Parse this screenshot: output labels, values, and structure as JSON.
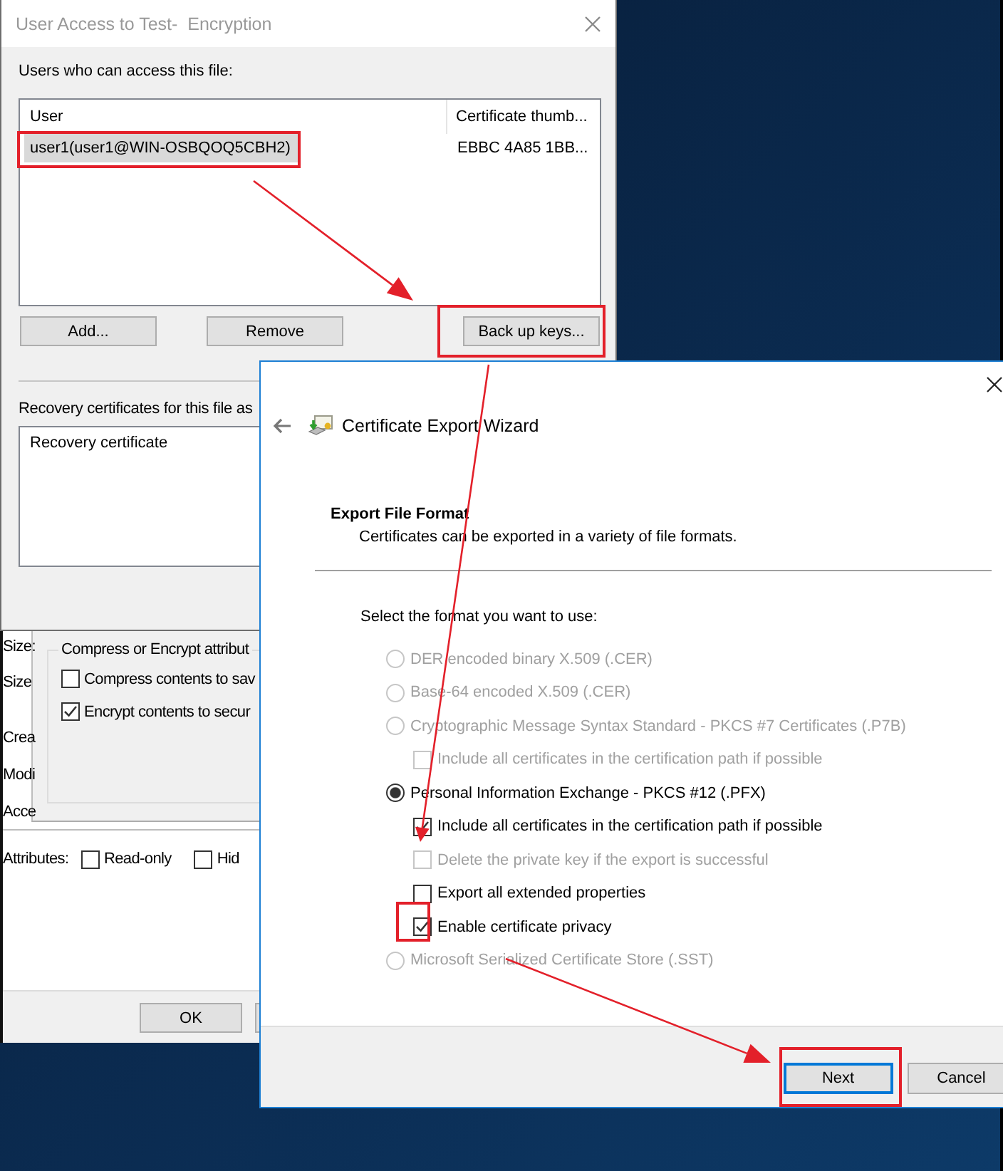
{
  "properties_window": {
    "side_labels": [
      "Size:",
      "Size",
      "Crea",
      "Modi",
      "Acce"
    ],
    "group_title": "Compress or Encrypt attribut",
    "group_options": [
      {
        "label": "Compress contents to sav",
        "checked": false
      },
      {
        "label": "Encrypt contents to secur",
        "checked": true
      }
    ],
    "attributes_label": "Attributes:",
    "attributes": [
      {
        "label": "Read-only",
        "checked": false
      },
      {
        "label": "Hid",
        "checked": false
      }
    ],
    "buttons": [
      "OK"
    ]
  },
  "user_access_dialog": {
    "title": "User Access to Test-  Encryption",
    "users_label": "Users who can access this file:",
    "columns": [
      "User",
      "Certificate thumb..."
    ],
    "rows": [
      {
        "user": "user1(user1@WIN-OSBQOQ5CBH2)",
        "thumbprint": "EBBC 4A85 1BB...",
        "selected": true
      }
    ],
    "buttons": [
      "Add...",
      "Remove",
      "Back up keys..."
    ],
    "recovery_label": "Recovery certificates for this file as",
    "recovery_columns": [
      "Recovery certificate"
    ]
  },
  "wizard": {
    "title": "Certificate Export Wizard",
    "heading": "Export File Format",
    "description": "Certificates can be exported in a variety of file formats.",
    "prompt": "Select the format you want to use:",
    "options": [
      {
        "kind": "radio",
        "label": "DER encoded binary X.509 (.CER)",
        "selected": false,
        "disabled": true
      },
      {
        "kind": "radio",
        "label": "Base-64 encoded X.509 (.CER)",
        "selected": false,
        "disabled": true
      },
      {
        "kind": "radio",
        "label": "Cryptographic Message Syntax Standard - PKCS #7 Certificates (.P7B)",
        "selected": false,
        "disabled": true,
        "children": [
          {
            "kind": "checkbox",
            "label": "Include all certificates in the certification path if possible",
            "checked": false,
            "disabled": true
          }
        ]
      },
      {
        "kind": "radio",
        "label": "Personal Information Exchange - PKCS #12 (.PFX)",
        "selected": true,
        "disabled": false,
        "children": [
          {
            "kind": "checkbox",
            "label": "Include all certificates in the certification path if possible",
            "checked": true,
            "disabled": false
          },
          {
            "kind": "checkbox",
            "label": "Delete the private key if the export is successful",
            "checked": false,
            "disabled": true
          },
          {
            "kind": "checkbox",
            "label": "Export all extended properties",
            "checked": false,
            "disabled": false
          },
          {
            "kind": "checkbox",
            "label": "Enable certificate privacy",
            "checked": true,
            "disabled": false
          }
        ]
      },
      {
        "kind": "radio",
        "label": "Microsoft Serialized Certificate Store (.SST)",
        "selected": false,
        "disabled": true
      }
    ],
    "buttons": [
      {
        "label": "Next",
        "default": true
      },
      {
        "label": "Cancel",
        "default": false
      }
    ]
  }
}
